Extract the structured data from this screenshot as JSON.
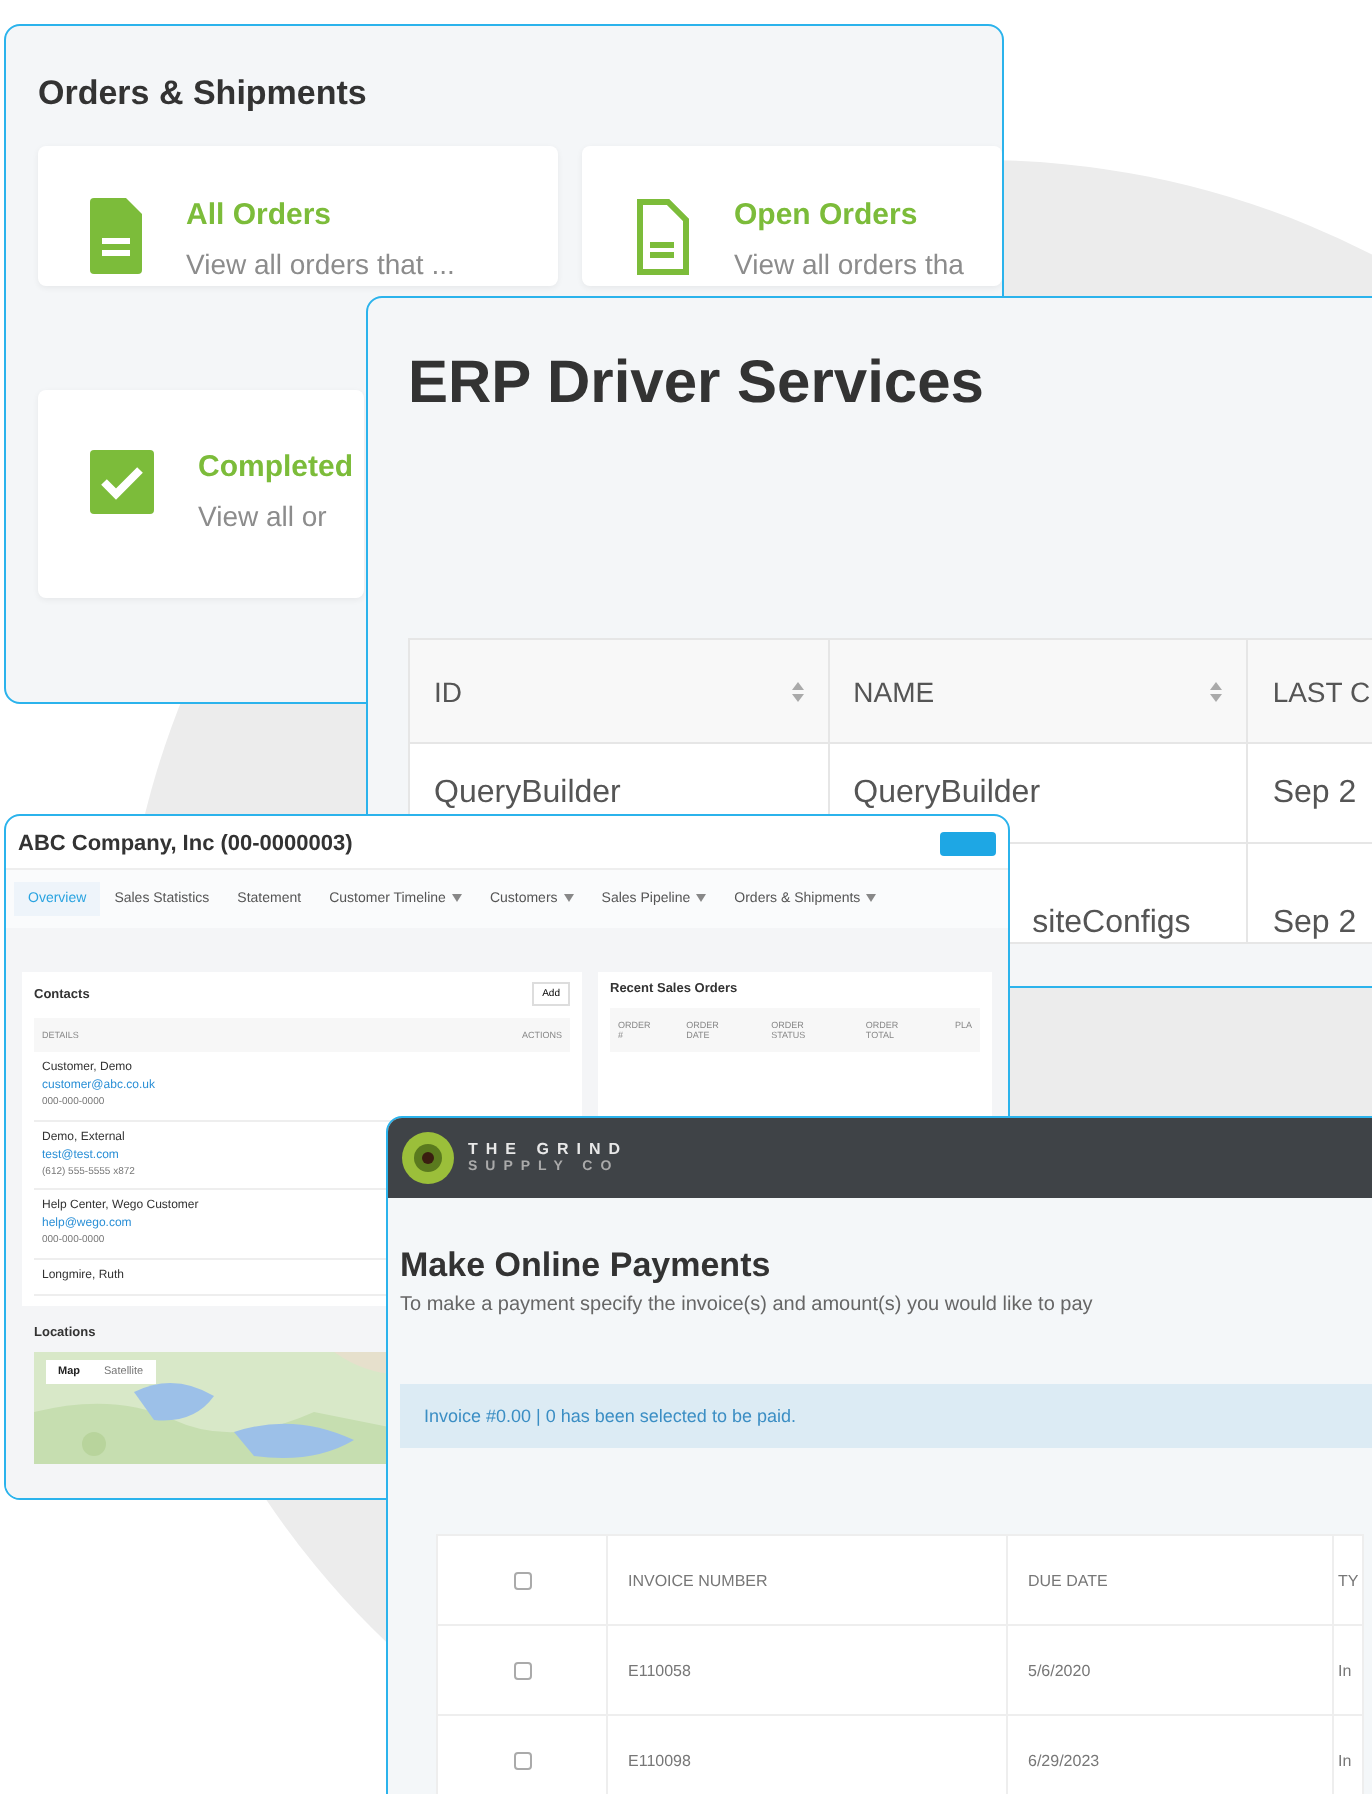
{
  "windows": [
    {
      "kind": "orders",
      "title": "Orders & Shipments",
      "cards": [
        {
          "title": "All Orders",
          "description": "View all orders that ..."
        },
        {
          "title": "Open Orders",
          "description": "View all orders tha"
        },
        {
          "title": "Completed",
          "description": "View all or"
        }
      ]
    },
    {
      "kind": "erp",
      "title": "ERP Driver Services",
      "columns": [
        {
          "label": "ID",
          "sortable": true
        },
        {
          "label": "NAME",
          "sortable": true
        },
        {
          "label": "LAST C",
          "sortable": false
        }
      ],
      "rows": [
        [
          "QueryBuilder",
          "QueryBuilder",
          "Sep 2"
        ],
        [
          null,
          "siteConfigs",
          "Sep 2"
        ]
      ]
    },
    {
      "kind": "company",
      "title": "ABC Company, Inc (00-0000003)",
      "tabs": [
        {
          "label": "Overview",
          "selected": true,
          "menu": false
        },
        {
          "label": "Sales Statistics",
          "selected": false,
          "menu": false
        },
        {
          "label": "Statement",
          "selected": false,
          "menu": false
        },
        {
          "label": "Customer Timeline",
          "selected": false,
          "menu": true
        },
        {
          "label": "Customers",
          "selected": false,
          "menu": true
        },
        {
          "label": "Sales Pipeline",
          "selected": false,
          "menu": true
        },
        {
          "label": "Orders & Shipments",
          "selected": false,
          "menu": true
        }
      ],
      "contacts": {
        "title": "Contacts",
        "add": "Add",
        "columns": [
          "DETAILS",
          "ACTIONS"
        ],
        "people": [
          {
            "name": "Customer, Demo",
            "email": "customer@abc.co.uk",
            "phone": "000-000-0000"
          },
          {
            "name": "Demo, External",
            "email": "test@test.com",
            "phone": "(612) 555-5555 x872"
          },
          {
            "name": "Help Center, Wego Customer",
            "email": "help@wego.com",
            "phone": "000-000-0000"
          },
          {
            "name": "Longmire, Ruth"
          }
        ]
      },
      "locations": {
        "title": "Locations",
        "map_tabs": [
          {
            "label": "Map",
            "selected": true
          },
          {
            "label": "Satellite",
            "selected": false
          }
        ]
      },
      "orders": {
        "title": "Recent Sales Orders",
        "columns": [
          "ORDER #",
          "ORDER DATE",
          "ORDER STATUS",
          "ORDER TOTAL",
          "PLA"
        ]
      }
    },
    {
      "kind": "payments",
      "brand": [
        "THE GRIND",
        "SUPPLY CO"
      ],
      "title": "Make Online Payments",
      "subtitle": "To make a payment specify the invoice(s) and amount(s) you would like to pay",
      "notice": "Invoice #0.00 | 0 has been selected to be paid.",
      "columns": [
        "INVOICE NUMBER",
        "DUE DATE",
        "TY"
      ],
      "header_checked": false,
      "rows": [
        {
          "checked": false,
          "cells": [
            "E110058",
            "5/6/2020",
            "In"
          ]
        },
        {
          "checked": false,
          "cells": [
            "E110098",
            "6/29/2023",
            "In"
          ]
        }
      ]
    }
  ]
}
